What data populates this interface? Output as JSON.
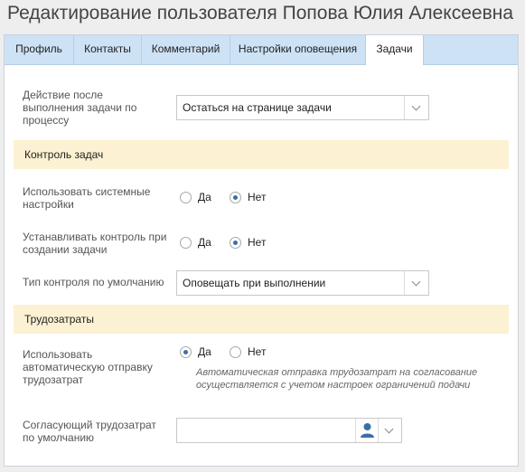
{
  "page": {
    "title": "Редактирование пользователя Попова Юлия Алексеевна"
  },
  "tabs": [
    {
      "label": "Профиль"
    },
    {
      "label": "Контакты"
    },
    {
      "label": "Комментарий"
    },
    {
      "label": "Настройки оповещения"
    },
    {
      "label": "Задачи",
      "active": true
    }
  ],
  "fields": {
    "after_action": {
      "label": "Действие после выполнения задачи по процессу",
      "value": "Остаться на странице задачи"
    },
    "use_system": {
      "label": "Использовать системные настройки",
      "yes": "Да",
      "no": "Нет",
      "selected": "no"
    },
    "set_control": {
      "label": "Устанавливать контроль при создании задачи",
      "yes": "Да",
      "no": "Нет",
      "selected": "no"
    },
    "control_type": {
      "label": "Тип контроля по умолчанию",
      "value": "Оповещать при выполнении"
    },
    "auto_send": {
      "label": "Использовать автоматическую отправку трудозатрат",
      "yes": "Да",
      "no": "Нет",
      "selected": "yes",
      "hint": "Автоматическая отправка трудозатрат на согласование осуществляется с учетом настроек ограничений подачи"
    },
    "approver": {
      "label": "Согласующий трудозатрат по умолчанию",
      "value": ""
    }
  },
  "sections": {
    "task_control": "Контроль задач",
    "labor": "Трудозатраты"
  },
  "colors": {
    "accent": "#3d6ea8",
    "tab_bar": "#cde2f5",
    "section_bg": "#fcf1d2"
  }
}
